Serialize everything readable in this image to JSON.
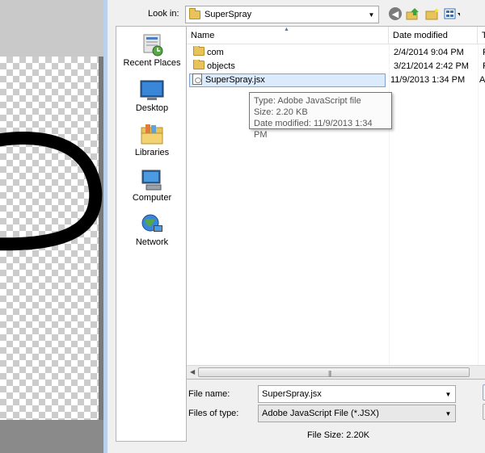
{
  "dialog": {
    "lookin_label": "Look in:",
    "lookin_value": "SuperSpray",
    "filename_label": "File name:",
    "filename_value": "SuperSpray.jsx",
    "filetype_label": "Files of type:",
    "filetype_value": "Adobe JavaScript File (*.JSX)",
    "filesize_text": "File Size: 2.20K"
  },
  "places": [
    {
      "label": "Recent Places",
      "icon": "recent-places-icon"
    },
    {
      "label": "Desktop",
      "icon": "desktop-icon"
    },
    {
      "label": "Libraries",
      "icon": "libraries-icon"
    },
    {
      "label": "Computer",
      "icon": "computer-icon"
    },
    {
      "label": "Network",
      "icon": "network-icon"
    }
  ],
  "columns": [
    "Name",
    "Date modified",
    "Ty"
  ],
  "files": [
    {
      "name": "com",
      "date": "2/4/2014 9:04 PM",
      "type": "Fi",
      "icon": "folder-icon"
    },
    {
      "name": "objects",
      "date": "3/21/2014 2:42 PM",
      "type": "Fi",
      "icon": "folder-icon"
    },
    {
      "name": "SuperSpray.jsx",
      "date": "11/9/2013 1:34 PM",
      "type": "A",
      "icon": "jsx-file-icon",
      "selected": true
    }
  ],
  "tooltip": {
    "type": "Type: Adobe JavaScript file",
    "size": "Size: 2.20 KB",
    "date": "Date modified: 11/9/2013 1:34 PM"
  },
  "colors": {
    "selection": "#dcebfc",
    "selection_border": "#7da2ce",
    "dialog_bg": "#f0f0f0"
  }
}
